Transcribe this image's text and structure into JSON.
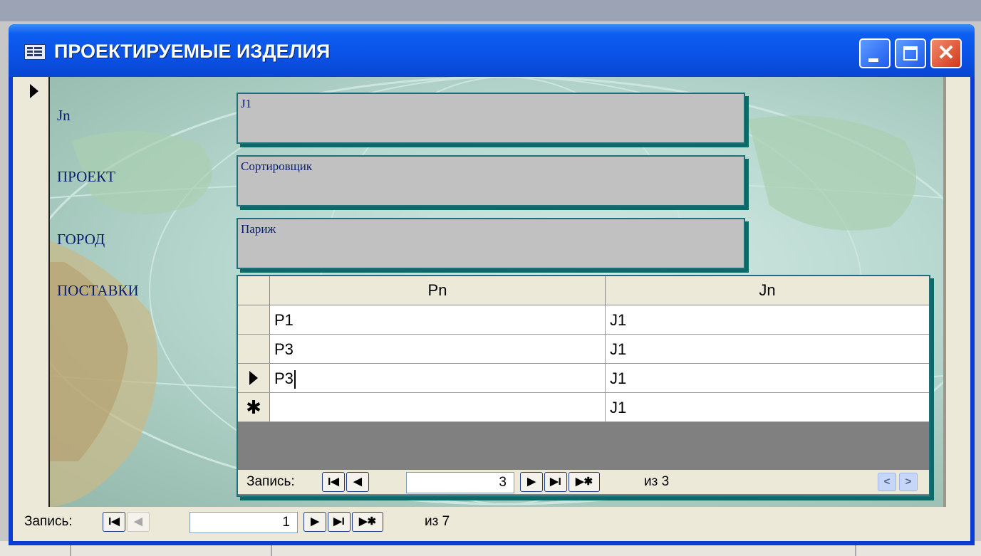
{
  "window": {
    "title": "ПРОЕКТИРУЕМЫЕ ИЗДЕЛИЯ",
    "close_glyph": "✕"
  },
  "form": {
    "fields": [
      {
        "label": "Jn",
        "value": "J1"
      },
      {
        "label": "ПРОЕКТ",
        "value": "Сортировщик"
      },
      {
        "label": "ГОРОД",
        "value": "Париж"
      }
    ],
    "subform_label": "ПОСТАВКИ"
  },
  "subform": {
    "columns": [
      "Pn",
      "Jn"
    ],
    "rows": [
      {
        "pn": "P1",
        "jn": "J1"
      },
      {
        "pn": "P3",
        "jn": "J1"
      },
      {
        "pn": "P3",
        "jn": "J1",
        "current": true
      },
      {
        "pn": "",
        "jn": "J1",
        "new_row_marker": "✱"
      }
    ],
    "nav": {
      "label": "Запись:",
      "current": "3",
      "of_text": "из 3",
      "first_glyph": "I◀",
      "prev_glyph": "◀",
      "next_glyph": "▶",
      "last_glyph": "▶I",
      "new_glyph": "▶✱"
    },
    "scroll": {
      "left_glyph": "<",
      "right_glyph": ">"
    }
  },
  "main_nav": {
    "label": "Запись:",
    "current": "1",
    "of_text": "из 7",
    "first_glyph": "I◀",
    "prev_glyph": "◀",
    "next_glyph": "▶",
    "last_glyph": "▶I",
    "new_glyph": "▶✱"
  }
}
